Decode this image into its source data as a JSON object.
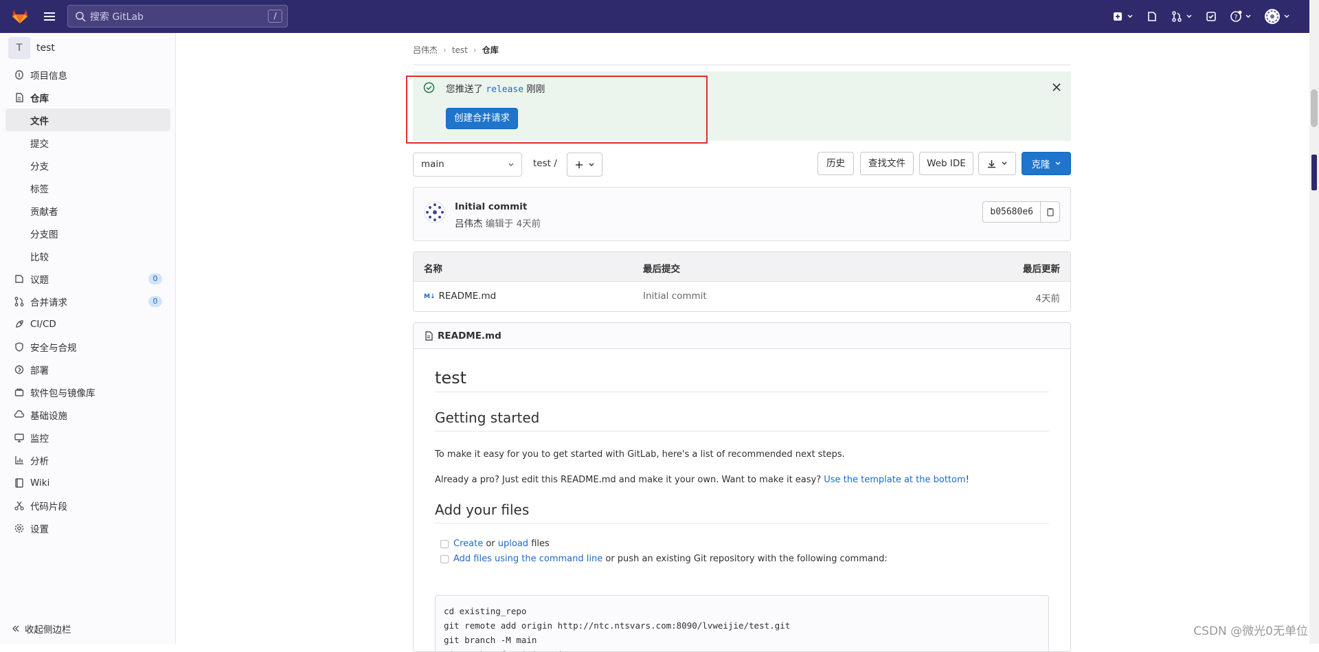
{
  "topbar": {
    "search_placeholder": "搜索 GitLab",
    "search_shortcut": "/"
  },
  "sidebar": {
    "project_initial": "T",
    "project_name": "test",
    "items": [
      {
        "label": "项目信息",
        "icon": "info-icon"
      },
      {
        "label": "仓库",
        "icon": "repository-icon"
      },
      {
        "label": "文件",
        "sub": true,
        "active": true
      },
      {
        "label": "提交",
        "sub": true
      },
      {
        "label": "分支",
        "sub": true
      },
      {
        "label": "标签",
        "sub": true
      },
      {
        "label": "贡献者",
        "sub": true
      },
      {
        "label": "分支图",
        "sub": true
      },
      {
        "label": "比较",
        "sub": true
      },
      {
        "label": "议题",
        "icon": "issues-icon",
        "badge": "0"
      },
      {
        "label": "合并请求",
        "icon": "merge-request-icon",
        "badge": "0"
      },
      {
        "label": "CI/CD",
        "icon": "rocket-icon"
      },
      {
        "label": "安全与合规",
        "icon": "shield-icon"
      },
      {
        "label": "部署",
        "icon": "deployments-icon"
      },
      {
        "label": "软件包与镜像库",
        "icon": "package-icon"
      },
      {
        "label": "基础设施",
        "icon": "cloud-gear-icon"
      },
      {
        "label": "监控",
        "icon": "monitor-icon"
      },
      {
        "label": "分析",
        "icon": "chart-icon"
      },
      {
        "label": "Wiki",
        "icon": "book-icon"
      },
      {
        "label": "代码片段",
        "icon": "snippet-icon"
      },
      {
        "label": "设置",
        "icon": "settings-icon"
      }
    ],
    "collapse_label": "收起侧边栏"
  },
  "breadcrumb": {
    "items": [
      "吕伟杰",
      "test",
      "仓库"
    ]
  },
  "alert": {
    "prefix": "您推送了 ",
    "branch": "release",
    "suffix": " 刚刚",
    "button": "创建合并请求"
  },
  "toolbar": {
    "branch": "main",
    "path": "test  /",
    "history": "历史",
    "find_file": "查找文件",
    "web_ide": "Web IDE",
    "clone": "克隆"
  },
  "commit": {
    "title": "Initial commit",
    "author": "吕伟杰",
    "meta": " 编辑于 4天前",
    "sha": "b05680e6"
  },
  "files": {
    "headers": [
      "名称",
      "最后提交",
      "最后更新"
    ],
    "rows": [
      {
        "name": "README.md",
        "commit": "Initial commit",
        "updated": "4天前"
      }
    ]
  },
  "readme": {
    "filename": "README.md",
    "h1": "test",
    "h2_started": "Getting started",
    "p1": "To make it easy for you to get started with GitLab, here's a list of recommended next steps.",
    "p2": "Already a pro? Just edit this README.md and make it your own. Want to make it easy? ",
    "p2_link": "Use the template at the bottom",
    "p2_end": "!",
    "h2_files": "Add your files",
    "task1_link1": "Create",
    "task1_or": " or ",
    "task1_link2": "upload",
    "task1_end": " files",
    "task2_link": "Add files using the command line",
    "task2_end": " or push an existing Git repository with the following command:",
    "code": "cd existing_repo\ngit remote add origin http://ntc.ntsvars.com:8090/lvweijie/test.git\ngit branch -M main\ngit push -uf origin main"
  },
  "watermark": "CSDN @微光0无单位"
}
